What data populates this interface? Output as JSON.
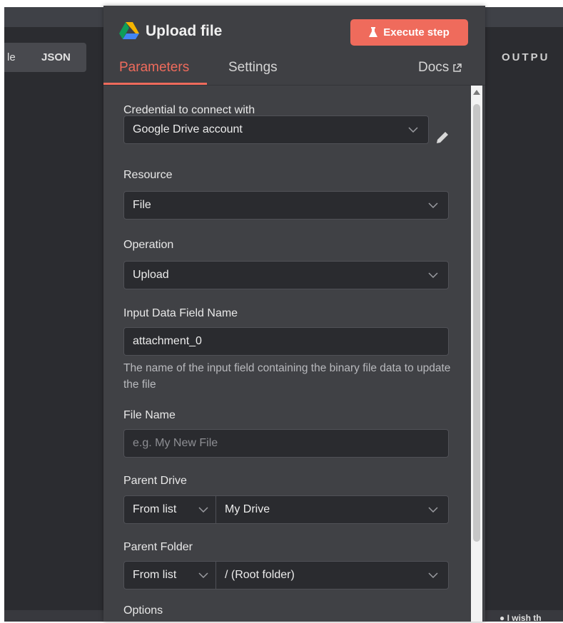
{
  "background": {
    "view_tabs": [
      "le",
      "JSON"
    ],
    "output_label": "OUTPU",
    "footer_hint": "I wish th"
  },
  "node": {
    "title": "Upload file",
    "execute_label": "Execute step",
    "tabs": {
      "parameters": "Parameters",
      "settings": "Settings",
      "docs": "Docs"
    }
  },
  "form": {
    "credential": {
      "label": "Credential to connect with",
      "value": "Google Drive account"
    },
    "resource": {
      "label": "Resource",
      "value": "File"
    },
    "operation": {
      "label": "Operation",
      "value": "Upload"
    },
    "input_field": {
      "label": "Input Data Field Name",
      "value": "attachment_0",
      "hint": "The name of the input field containing the binary file data to update the file"
    },
    "file_name": {
      "label": "File Name",
      "placeholder": "e.g. My New File"
    },
    "parent_drive": {
      "label": "Parent Drive",
      "mode": "From list",
      "value": "My Drive"
    },
    "parent_folder": {
      "label": "Parent Folder",
      "mode": "From list",
      "value": "/ (Root folder)"
    },
    "options": {
      "label": "Options"
    }
  },
  "colors": {
    "accent": "#ef6b5c",
    "panel": "#404145",
    "field": "#2a2b2f",
    "canvas": "#2b2c30"
  }
}
